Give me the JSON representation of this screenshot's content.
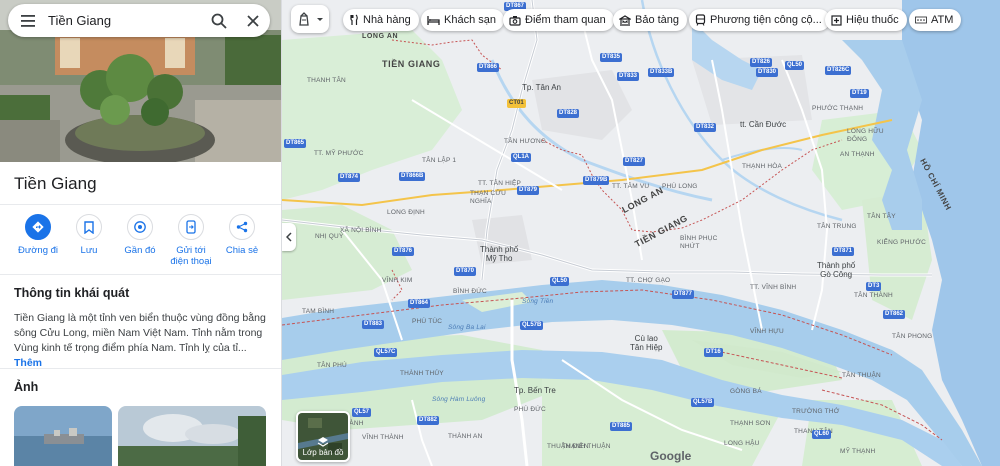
{
  "search": {
    "value": "Tiền Giang"
  },
  "place": {
    "title": "Tiền Giang",
    "actions": [
      {
        "label": "Đường đi"
      },
      {
        "label": "Lưu"
      },
      {
        "label": "Gần đó"
      },
      {
        "label": "Gửi tới điện thoại"
      },
      {
        "label": "Chia sẻ"
      }
    ],
    "about_heading": "Thông tin khái quát",
    "about_text": "Tiền Giang là một tỉnh ven biển thuộc vùng đồng bằng sông Cửu Long, miền Nam Việt Nam. Tỉnh nằm trong Vùng kinh tế trọng điểm phía Nam. Tỉnh lỵ của tỉ...",
    "about_more": "Thêm",
    "photos_heading": "Ảnh"
  },
  "filters": [
    {
      "label": "Nhà hàng",
      "icon": "restaurant-icon"
    },
    {
      "label": "Khách sạn",
      "icon": "hotel-icon"
    },
    {
      "label": "Điểm tham quan",
      "icon": "camera-icon"
    },
    {
      "label": "Bảo tàng",
      "icon": "museum-icon"
    },
    {
      "label": "Phương tiện công cộ...",
      "icon": "transit-icon"
    },
    {
      "label": "Hiệu thuốc",
      "icon": "pharmacy-icon"
    },
    {
      "label": "ATM",
      "icon": "atm-icon"
    }
  ],
  "map": {
    "layer_label": "Lớp bản đồ",
    "logo": "Google",
    "labels": {
      "long_an": "LONG AN",
      "tien_giang": "TIỀN GIANG",
      "long_an_diag": "LONG AN",
      "tien_giang_diag": "TIỀN GIANG",
      "ho_chi_minh": "HỒ CHÍ MINH",
      "tan_an": "Tp. Tân An",
      "my_tho": "Thành phố\nMỹ Tho",
      "go_cong": "Thành phố\nGò Công",
      "ben_tre": "Tp. Bến Tre",
      "can_duoc": "tt. Cần Đước",
      "cu_lao": "Cù lao\nTân Hiệp",
      "thanh_tan": "THANH TÂN",
      "tt_my_phuoc": "TT. MỸ PHƯỚC",
      "tan_lap": "TÂN LẬP 1",
      "tan_huong": "TÂN HƯƠNG",
      "tt_tan_hiep": "TT. TÂN HIỆP",
      "than_cuu_nghia": "THẠN CỬU\nNGHĨA",
      "long_dinh": "LONG ĐỊNH",
      "xa_noi_binh": "XÃ NỘI BÌNH",
      "nhi_quy": "NHỊ QUÝ",
      "vinh_kim": "VĨNH KIM",
      "binh_duc": "BÌNH ĐỨC",
      "tam_binh": "TAM BÌNH",
      "phu_tuc": "PHÚ TÚC",
      "tan_phu": "TÂN PHÚ",
      "thanh_thuy": "THÀNH THỦY",
      "phu_duc": "PHÚ ĐỨC",
      "vinh_thanh": "VĨNH THÀNH",
      "thanh_an": "THÀNH AN",
      "thanh_thuan": "THẠNH THUẬN",
      "tt_cho_gao": "TT. CHỢ GẠO",
      "tt_tam_vu": "TT. TÂM VU",
      "phu_long": "PHÚ LONG",
      "binh_phuc_nhut": "BÌNH PHỤC\nNHỨT",
      "thanh_hoa": "THẠNH HÒA",
      "an_thanh": "AN THẠNH",
      "phuoc_thanh": "PHƯỚC THẠNH",
      "tt_vinh_binh": "TT. VĨNH BÌNH",
      "vinh_hiu": "VĨNH HỰU",
      "tan_tay": "TÂN TÂY",
      "tan_trung": "TÂN TRUNG",
      "kieng_phuoc": "KIỂNG PHƯỚC",
      "long_huu": "LONG HỮU\nĐÔNG",
      "tan_thanh": "TÂN THÀNH",
      "tan_thuan": "TÂN THUẬN",
      "tan_phong": "TÂN PHONG",
      "thanh_son": "THẠNH SƠN",
      "thuan_dien": "THUẬN ĐIỀN",
      "truong_tho": "TRƯỜNG THỚ",
      "gong_ba": "GÒNG BÁ",
      "thanh_tan2": "THANH TÂN",
      "vinh_thanh2": "VĨNH THÀNH",
      "my_thanh": "MỸ THẠNH",
      "long_hau": "LONG HẬU",
      "song_tien": "Sông Tiền",
      "song_ba_lai": "Sông Ba Lai",
      "song_ham": "Sông Hàm Luông"
    },
    "shields": [
      "DT866",
      "DT867",
      "DT835",
      "DT833",
      "DT833B",
      "DT826",
      "DT830",
      "QL50",
      "DT826C",
      "DT865",
      "DT828",
      "CT01",
      "DT874",
      "DT866B",
      "QL1A",
      "DT879",
      "DT879B",
      "DT827",
      "DT876",
      "DT870",
      "QL50",
      "DT877",
      "DT864",
      "QL57B",
      "QL57C",
      "DT883",
      "QL57",
      "DT16",
      "DT871",
      "DT862",
      "QL57B",
      "DT882",
      "DT885",
      "QL60",
      "DT3",
      "DT19",
      "DT832"
    ]
  }
}
